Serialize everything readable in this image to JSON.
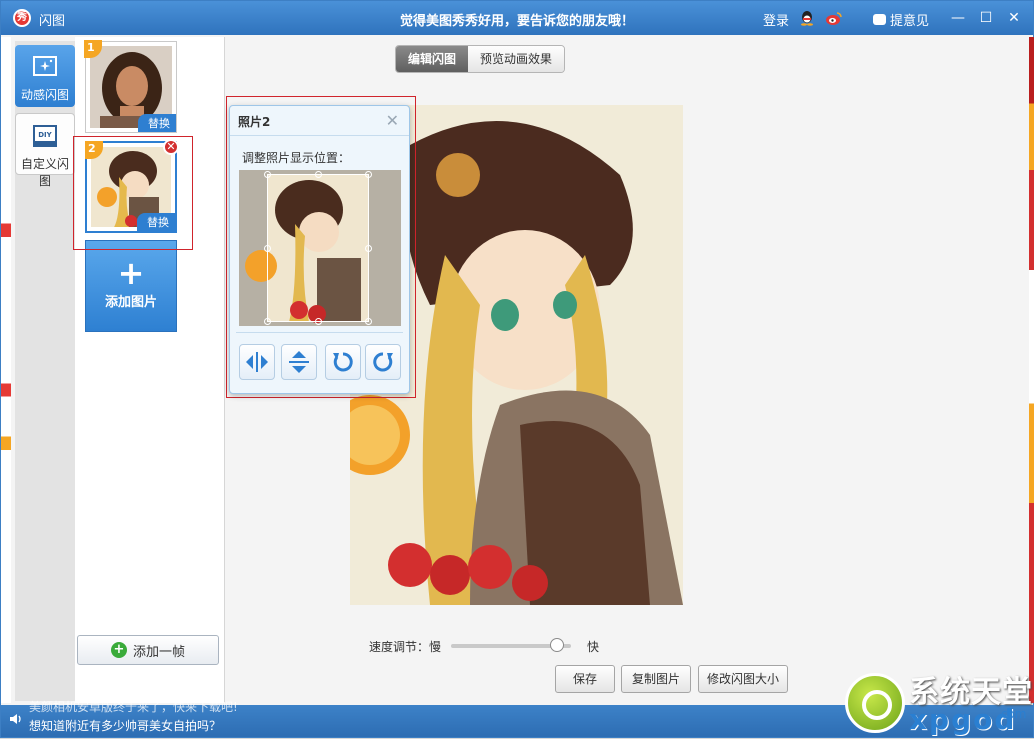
{
  "window": {
    "app_title": "闪图",
    "app_logo": "秀",
    "slogan": "觉得美图秀秀好用，要告诉您的朋友哦！",
    "login_label": "登录",
    "feedback_label": "提意见",
    "min_glyph": "—",
    "max_glyph": "☐",
    "close_glyph": "✕"
  },
  "left_tabs": [
    {
      "label": "动感闪图",
      "icon": "sparkle-frame-icon"
    },
    {
      "label": "自定义闪图",
      "icon": "diy-icon",
      "icon_text": "DIY"
    }
  ],
  "thumbnails": [
    {
      "number": "1",
      "replace_label": "替换"
    },
    {
      "number": "2",
      "replace_label": "替换",
      "close_glyph": "✕"
    }
  ],
  "add_photo": {
    "plus": "+",
    "label": "添加图片"
  },
  "add_frame": {
    "label": "添加一帧",
    "plus": "+"
  },
  "mode_tabs": {
    "edit": "编辑闪图",
    "preview": "预览动画效果"
  },
  "popup": {
    "title": "照片2",
    "close_glyph": "✕",
    "label": "调整照片显示位置：",
    "tools": [
      "flip-horizontal-icon",
      "flip-vertical-icon",
      "rotate-left-icon",
      "rotate-right-icon"
    ]
  },
  "speed": {
    "label": "速度调节：慢",
    "fast_label": "快",
    "value": 0.88
  },
  "buttons": {
    "save": "保存",
    "copy": "复制图片",
    "resize": "修改闪图大小"
  },
  "status": {
    "line1": "美颜相机安卓版终于来了，快来下载吧!",
    "line2": "想知道附近有多少帅哥美女自拍吗？"
  },
  "watermark": {
    "text": "系统天堂",
    "sub": "xpgod",
    "dot": ".com"
  },
  "colors": {
    "accent": "#2e7fd1",
    "titlebar": "#3b82cc",
    "highlight": "#d0242c"
  }
}
